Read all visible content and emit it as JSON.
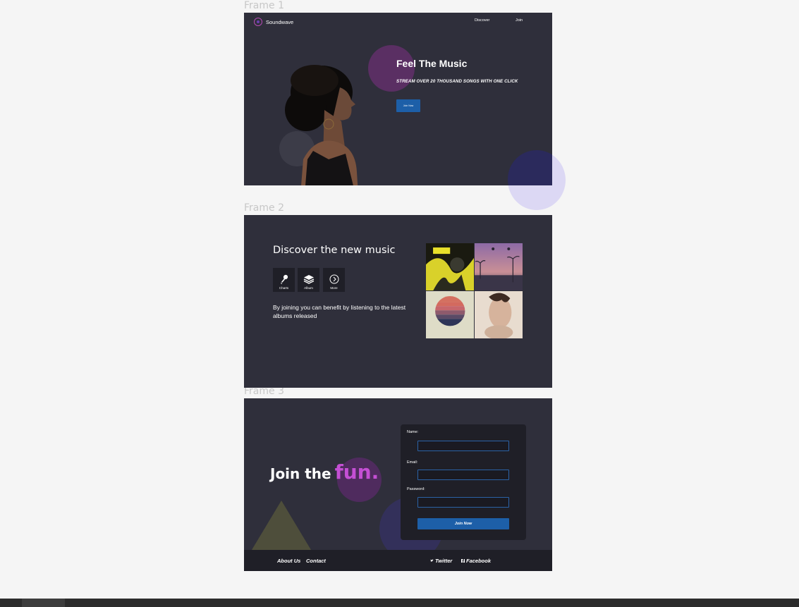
{
  "frames": [
    {
      "label": "Frame 1"
    },
    {
      "label": "Frame 2"
    },
    {
      "label": "Frame 3"
    }
  ],
  "frame1": {
    "brand": "Soundwave",
    "nav": [
      "Discover",
      "Join"
    ],
    "title": "Feel The Music",
    "subtitle": "STREAM OVER 20 THOUSAND SONGS WITH ONE CLICK",
    "cta": "Join Now"
  },
  "frame2": {
    "title": "Discover the new music",
    "features": [
      {
        "label": "Charts",
        "icon": "microphone-icon"
      },
      {
        "label": "Album",
        "icon": "layers-icon"
      },
      {
        "label": "More",
        "icon": "chevron-right-circle-icon"
      }
    ],
    "description": "By joining you can benefit by listening to the latest albums released"
  },
  "frame3": {
    "title_part1": "Join the",
    "title_part2": "fun.",
    "form": {
      "name_label": "Name:",
      "email_label": "Email:",
      "password_label": "Password:",
      "submit": "Join Now"
    },
    "footer": {
      "about": "About Us",
      "contact": "Contact",
      "twitter": "Twitter",
      "facebook": "Facebook"
    }
  },
  "colors": {
    "frame_bg": "#2f2f3b",
    "accent_blue": "#1d5fa8",
    "accent_purple": "#c44fd4",
    "card_bg": "#1f1f27"
  }
}
